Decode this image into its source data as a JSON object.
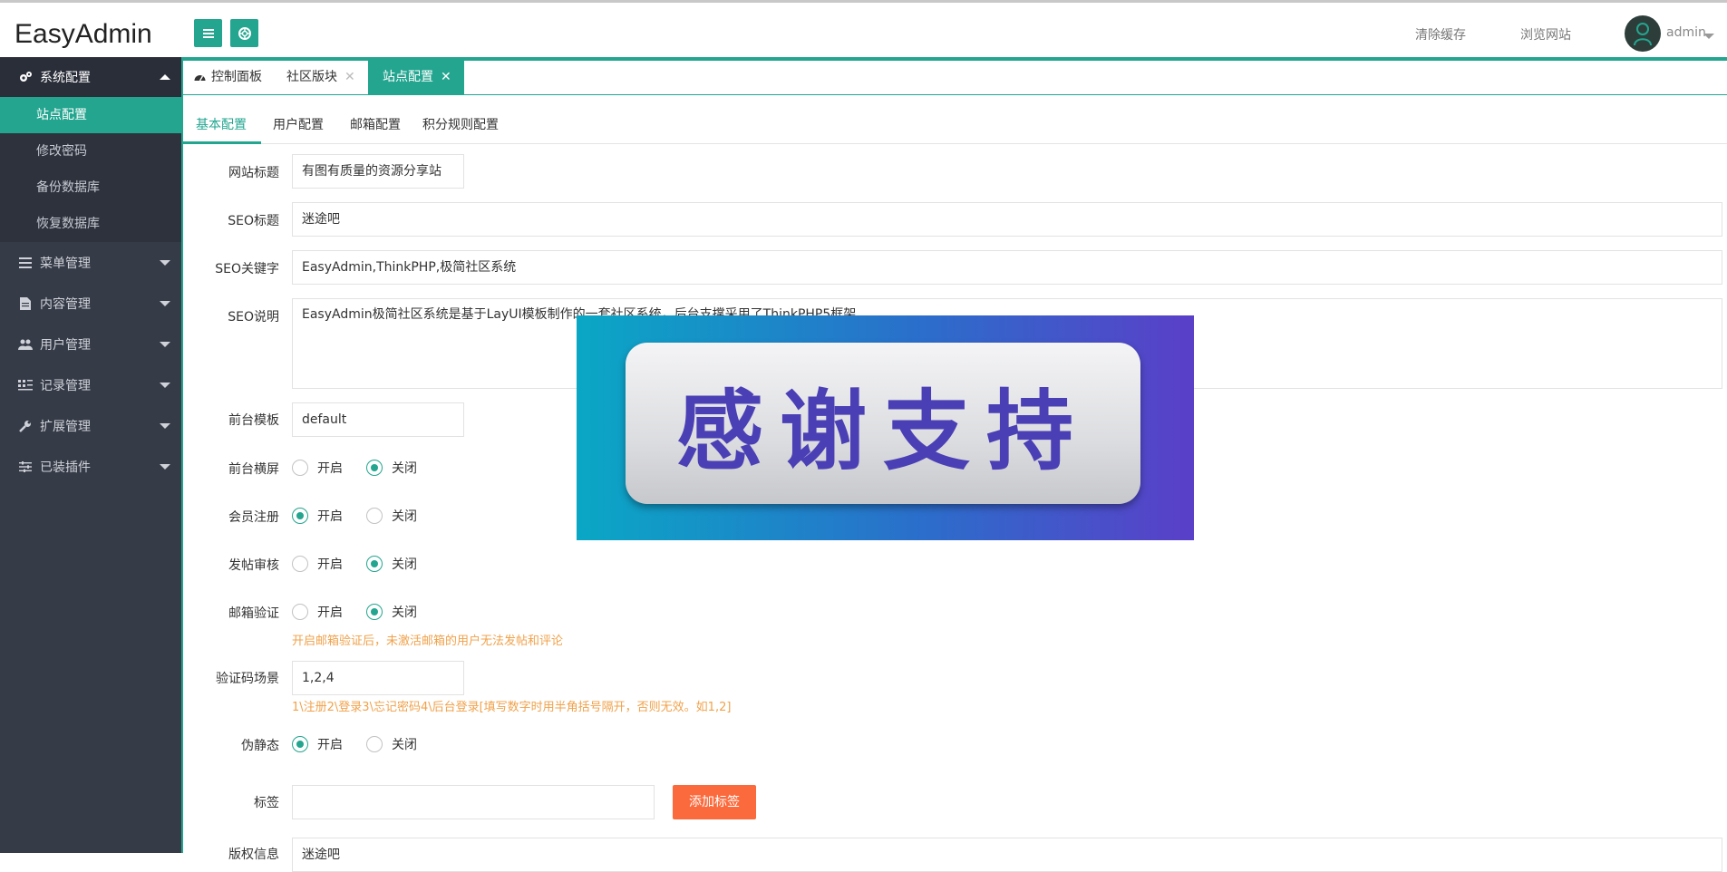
{
  "header": {
    "logo": "EasyAdmin",
    "clear_cache": "清除缓存",
    "browse_site": "浏览网站",
    "username": "admin"
  },
  "sidebar": {
    "groups": [
      {
        "label": "系统配置",
        "icon": "gears-icon",
        "open": true
      },
      {
        "label": "菜单管理",
        "icon": "list-icon"
      },
      {
        "label": "内容管理",
        "icon": "file-icon"
      },
      {
        "label": "用户管理",
        "icon": "users-icon"
      },
      {
        "label": "记录管理",
        "icon": "grid-icon"
      },
      {
        "label": "扩展管理",
        "icon": "wrench-icon"
      },
      {
        "label": "已装插件",
        "icon": "sliders-icon"
      }
    ],
    "subitems": [
      "站点配置",
      "修改密码",
      "备份数据库",
      "恢复数据库"
    ],
    "active_subitem": "站点配置"
  },
  "tabs": [
    {
      "label": "控制面板",
      "icon": "dashboard-icon"
    },
    {
      "label": "社区版块",
      "close": "✕"
    },
    {
      "label": "站点配置",
      "close": "✕",
      "active": true
    }
  ],
  "subtabs": [
    "基本配置",
    "用户配置",
    "邮箱配置",
    "积分规则配置"
  ],
  "form": {
    "site_title": {
      "label": "网站标题",
      "value": "有图有质量的资源分享站"
    },
    "seo_title": {
      "label": "SEO标题",
      "value": "迷途吧"
    },
    "seo_keywords": {
      "label": "SEO关键字",
      "value": "EasyAdmin,ThinkPHP,极简社区系统"
    },
    "seo_desc": {
      "label": "SEO说明",
      "value": "EasyAdmin极简社区系统是基于LayUI模板制作的一套社区系统，后台支撑采用了ThinkPHP5框架"
    },
    "template": {
      "label": "前台模板",
      "value": "default"
    },
    "wide_screen": {
      "label": "前台横屏",
      "on": "开启",
      "off": "关闭",
      "selected": "off"
    },
    "member_register": {
      "label": "会员注册",
      "on": "开启",
      "off": "关闭",
      "selected": "on"
    },
    "post_review": {
      "label": "发帖审核",
      "on": "开启",
      "off": "关闭",
      "selected": "off"
    },
    "email_verify": {
      "label": "邮箱验证",
      "on": "开启",
      "off": "关闭",
      "selected": "off",
      "hint": "开启邮箱验证后，未激活邮箱的用户无法发帖和评论"
    },
    "captcha_scene": {
      "label": "验证码场景",
      "value": "1,2,4",
      "hint": "1\\注册2\\登录3\\忘记密码4\\后台登录[填写数字时用半角括号隔开，否则无效。如1,2]"
    },
    "pseudo_static": {
      "label": "伪静态",
      "on": "开启",
      "off": "关闭",
      "selected": "on"
    },
    "tags": {
      "label": "标签",
      "value": "",
      "button": "添加标签"
    },
    "copyright": {
      "label": "版权信息",
      "value": "迷途吧"
    }
  },
  "overlay": {
    "text": "感谢支持"
  },
  "colors": {
    "accent": "#23a58f",
    "sidebar": "#363b48",
    "hint": "#f0a24b",
    "button": "#fb6a3c"
  }
}
